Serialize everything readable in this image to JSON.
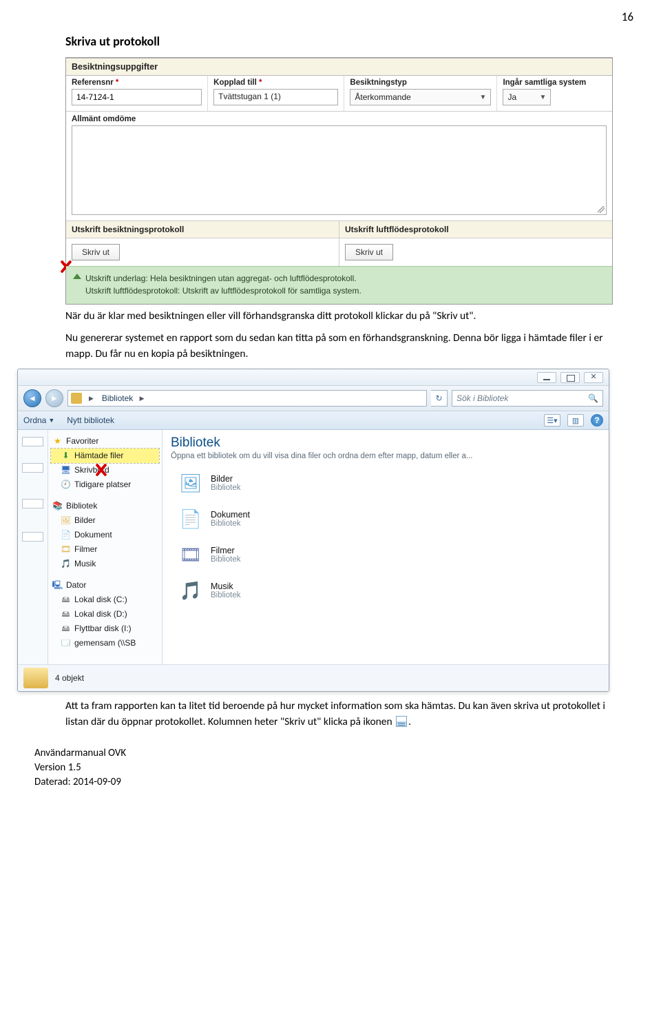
{
  "page_number": "16",
  "heading": "Skriva ut protokoll",
  "form": {
    "section1_title": "Besiktningsuppgifter",
    "fields": {
      "ref_label": "Referensnr",
      "ref_value": "14-7124-1",
      "kopplad_label": "Kopplad till",
      "kopplad_value": "Tvättstugan 1 (1)",
      "typ_label": "Besiktningstyp",
      "typ_value": "Återkommande",
      "ingar_label": "Ingår samtliga system",
      "ingar_value": "Ja"
    },
    "allmant_label": "Allmänt omdöme",
    "print_left_title": "Utskrift besiktningsprotokoll",
    "print_right_title": "Utskrift luftflödesprotokoll",
    "print_btn": "Skriv ut",
    "info_line1": "Utskrift underlag: Hela besiktningen utan aggregat- och luftflödesprotokoll.",
    "info_line2": "Utskrift luftflödesprotokoll: Utskrift av luftflödesprotokoll för samtliga system."
  },
  "para1": "När du är klar med besiktningen eller vill förhandsgranska ditt protokoll klickar du på \"Skriv ut\".",
  "para2": "Nu genererar systemet en rapport som du sedan kan titta på som en förhandsgranskning. Denna bör ligga i hämtade filer i er mapp. Du får nu en kopia på besiktningen.",
  "explorer": {
    "crumb": "Bibliotek",
    "search_placeholder": "Sök i Bibliotek",
    "tool_ordna": "Ordna",
    "tool_nytt": "Nytt bibliotek",
    "nav_fav": "Favoriter",
    "nav_dl": "Hämtade filer",
    "nav_desk": "Skrivbord",
    "nav_recent": "Tidigare platser",
    "nav_lib": "Bibliotek",
    "nav_bilder": "Bilder",
    "nav_dok": "Dokument",
    "nav_filmer": "Filmer",
    "nav_musik": "Musik",
    "nav_comp": "Dator",
    "nav_c": "Lokal disk (C:)",
    "nav_d": "Lokal disk (D:)",
    "nav_i": "Flyttbar disk (I:)",
    "nav_gem": "gemensam (\\\\SB",
    "main_title": "Bibliotek",
    "main_sub": "Öppna ett bibliotek om du vill visa dina filer och ordna dem efter mapp, datum eller a...",
    "lib_bilder": "Bilder",
    "lib_dok": "Dokument",
    "lib_filmer": "Filmer",
    "lib_musik": "Musik",
    "lib_sub": "Bibliotek",
    "status": "4 objekt"
  },
  "para3a": "Att ta fram rapporten kan ta litet tid beroende på hur mycket information som ska hämtas. Du kan även skriva ut protokollet i listan där du öppnar protokollet. Kolumnen heter \"Skriv",
  "para3b": "ut\" klicka på ikonen",
  "para3c": ".",
  "footer": {
    "l1": "Användarmanual OVK",
    "l2": "Version 1.5",
    "l3": "Daterad: 2014-09-09"
  }
}
